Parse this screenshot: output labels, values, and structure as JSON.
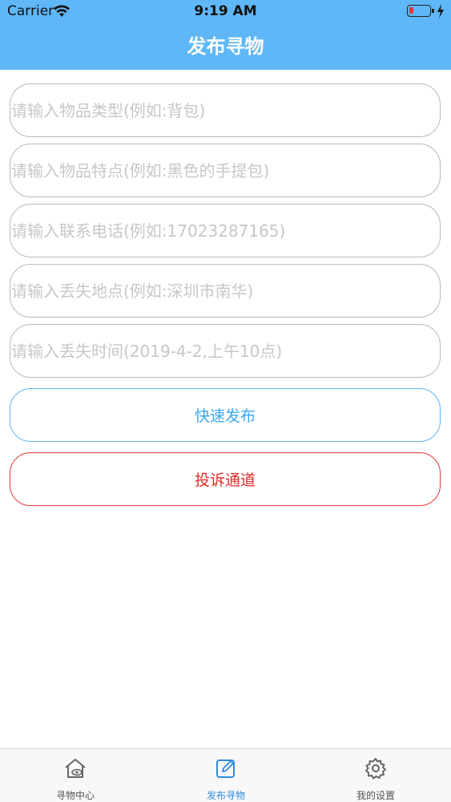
{
  "status_bar": {
    "carrier": "Carrier",
    "time": "9:19 AM"
  },
  "nav": {
    "title": "发布寻物"
  },
  "form": {
    "item_type": {
      "value": "",
      "placeholder": "请输入物品类型(例如:背包)"
    },
    "item_features": {
      "value": "",
      "placeholder": "请输入物品特点(例如:黑色的手提包)"
    },
    "contact_phone": {
      "value": "",
      "placeholder": "请输入联系电话(例如:17023287165)"
    },
    "lost_location": {
      "value": "",
      "placeholder": "请输入丢失地点(例如:深圳市南华)"
    },
    "lost_time": {
      "value": "",
      "placeholder": "请输入丢失时间(2019-4-2,上午10点)"
    }
  },
  "buttons": {
    "publish": "快速发布",
    "complain": "投诉通道"
  },
  "tabs": [
    {
      "label": "寻物中心",
      "icon": "home-eye-icon"
    },
    {
      "label": "发布寻物",
      "icon": "edit-icon"
    },
    {
      "label": "我的设置",
      "icon": "gear-icon"
    }
  ],
  "colors": {
    "accent": "#5fb7f7",
    "danger": "#e53935"
  }
}
